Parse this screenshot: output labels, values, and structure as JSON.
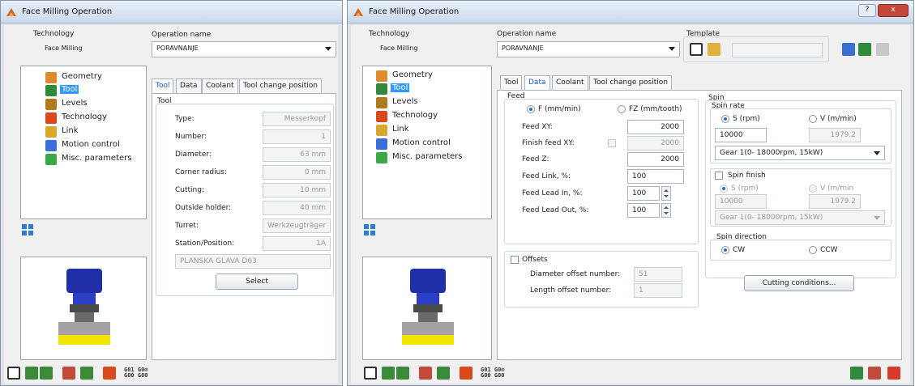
{
  "colors": {
    "accent": "#3399ff",
    "tab_active": "#1a55c4",
    "tool_blue": "#1f2fa8",
    "tool_yellow": "#f2e300"
  },
  "win1": {
    "title": "Face Milling Operation",
    "technology_label": "Technology",
    "technology_value": "Face Milling",
    "operation_label": "Operation name",
    "operation_value": "PORAVNANJE",
    "tree": [
      {
        "label": "Geometry",
        "icon": "geometry-icon"
      },
      {
        "label": "Tool",
        "icon": "tool-icon",
        "selected": true
      },
      {
        "label": "Levels",
        "icon": "levels-icon"
      },
      {
        "label": "Technology",
        "icon": "technology-icon"
      },
      {
        "label": "Link",
        "icon": "link-icon"
      },
      {
        "label": "Motion control",
        "icon": "motion-control-icon"
      },
      {
        "label": "Misc. parameters",
        "icon": "misc-parameters-icon"
      }
    ],
    "tabs": [
      "Tool",
      "Data",
      "Coolant",
      "Tool change position"
    ],
    "tool_group": "Tool",
    "fields": [
      {
        "label": "Type:",
        "value": "Messerkopf"
      },
      {
        "label": "Number:",
        "value": "1"
      },
      {
        "label": "Diameter:",
        "value": "63 mm"
      },
      {
        "label": "Corner radius:",
        "value": "0 mm"
      },
      {
        "label": "Cutting:",
        "value": "10 mm"
      },
      {
        "label": "Outside holder:",
        "value": "40 mm"
      },
      {
        "label": "Turret:",
        "value": "Werkzeugträger"
      },
      {
        "label": "Station/Position:",
        "value": "1A"
      }
    ],
    "tool_name": "PLANSKA GLAVA D63",
    "select_button": "Select",
    "gcode_icon_top": "G01 G0⊙",
    "gcode_icon_bottom": "G00 G00"
  },
  "win2": {
    "title": "Face Milling Operation",
    "technology_label": "Technology",
    "technology_value": "Face Milling",
    "operation_label": "Operation name",
    "operation_value": "PORAVNANJE",
    "template_label": "Template",
    "help_glyph": "?",
    "close_glyph": "x",
    "tree": [
      {
        "label": "Geometry",
        "icon": "geometry-icon"
      },
      {
        "label": "Tool",
        "icon": "tool-icon",
        "selected": true
      },
      {
        "label": "Levels",
        "icon": "levels-icon"
      },
      {
        "label": "Technology",
        "icon": "technology-icon"
      },
      {
        "label": "Link",
        "icon": "link-icon"
      },
      {
        "label": "Motion control",
        "icon": "motion-control-icon"
      },
      {
        "label": "Misc. parameters",
        "icon": "misc-parameters-icon"
      }
    ],
    "tabs": [
      "Tool",
      "Data",
      "Coolant",
      "Tool change position"
    ],
    "feed": {
      "group": "Feed",
      "radio_f": "F (mm/min)",
      "radio_fz": "FZ (mm/tooth)",
      "rows": [
        {
          "label": "Feed XY:",
          "value": "2000"
        },
        {
          "label": "Finish feed XY:",
          "value": "2000"
        },
        {
          "label": "Feed Z:",
          "value": "2000"
        },
        {
          "label": "Feed Link, %:",
          "value": "100"
        },
        {
          "label": "Feed Lead In, %:",
          "value": "100"
        },
        {
          "label": "Feed Lead Out, %:",
          "value": "100"
        }
      ]
    },
    "offsets": {
      "group": "Offsets",
      "diameter_label": "Diameter offset number:",
      "diameter_value": "51",
      "length_label": "Length offset number:",
      "length_value": "1"
    },
    "spin": {
      "group": "Spin",
      "rate_group": "Spin rate",
      "radio_s": "S (rpm)",
      "radio_v": "V (m/min)",
      "s_value": "10000",
      "v_value": "1979.2",
      "gear": "Gear 1(0- 18000rpm, 15kW)",
      "finish_label": "Spin finish",
      "finish_s_label": "S (rpm)",
      "finish_v_label": "V (m/min",
      "finish_s_value": "10000",
      "finish_v_value": "1979.2",
      "finish_gear": "Gear 1(0- 18000rpm, 15kW)",
      "direction_group": "Spin direction",
      "cw": "CW",
      "ccw": "CCW"
    },
    "cutting_button": "Cutting conditions...",
    "gcode_icon_top": "G01 G0⊙",
    "gcode_icon_bottom": "G00 G00"
  }
}
